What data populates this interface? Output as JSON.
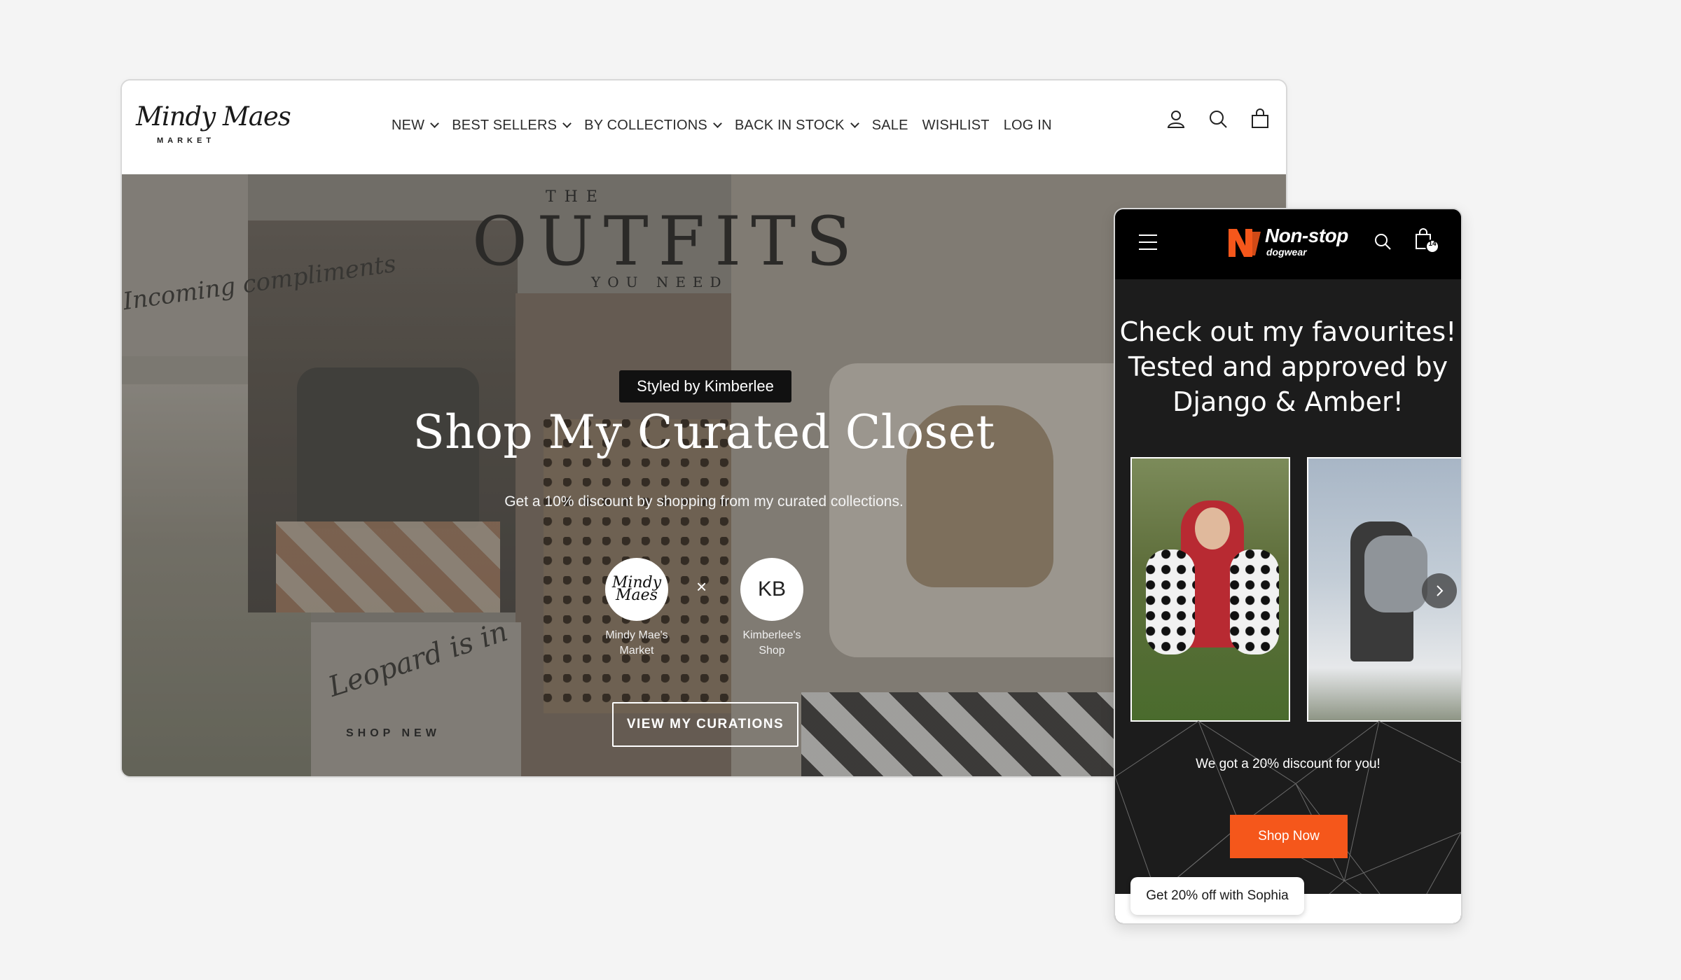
{
  "desktop": {
    "logo": {
      "script": "Mindy Maes",
      "sub": "MARKET"
    },
    "nav": [
      {
        "label": "NEW",
        "dropdown": true
      },
      {
        "label": "BEST SELLERS",
        "dropdown": true
      },
      {
        "label": "BY COLLECTIONS",
        "dropdown": true
      },
      {
        "label": "BACK IN STOCK",
        "dropdown": true
      },
      {
        "label": "SALE",
        "dropdown": false
      },
      {
        "label": "WISHLIST",
        "dropdown": false
      },
      {
        "label": "LOG IN",
        "dropdown": false
      }
    ],
    "header_icons": [
      "account-icon",
      "search-icon",
      "cart-icon"
    ],
    "hero": {
      "bg_the": "THE",
      "bg_outfits": "OUTFITS",
      "bg_you_need": "YOU NEED",
      "script_note_1": "Incoming compliments",
      "script_note_2": "Leopard is in",
      "shop_new": "SHOP NEW",
      "styled_by": "Styled by Kimberlee",
      "title": "Shop My Curated Closet",
      "subtitle": "Get a 10% discount by shopping from my curated collections.",
      "partner_1_avatar": "Mindy Maes",
      "partner_1_label_line1": "Mindy Mae's",
      "partner_1_label_line2": "Market",
      "times": "×",
      "partner_2_avatar": "KB",
      "partner_2_label_line1": "Kimberlee's",
      "partner_2_label_line2": "Shop",
      "cta": "VIEW MY CURATIONS"
    }
  },
  "mobile": {
    "logo": {
      "name": "Non-stop",
      "sub": "dogwear"
    },
    "cart_count": "14",
    "title_line1": "Check out my favourites!",
    "title_line2": "Tested and approved by",
    "title_line3": "Django & Amber!",
    "promo": "We got a 20% discount for you!",
    "cta": "Shop Now",
    "chat_bubble": "Get 20% off with Sophia",
    "colors": {
      "accent": "#f5571b",
      "background": "#1c1c1c"
    }
  }
}
